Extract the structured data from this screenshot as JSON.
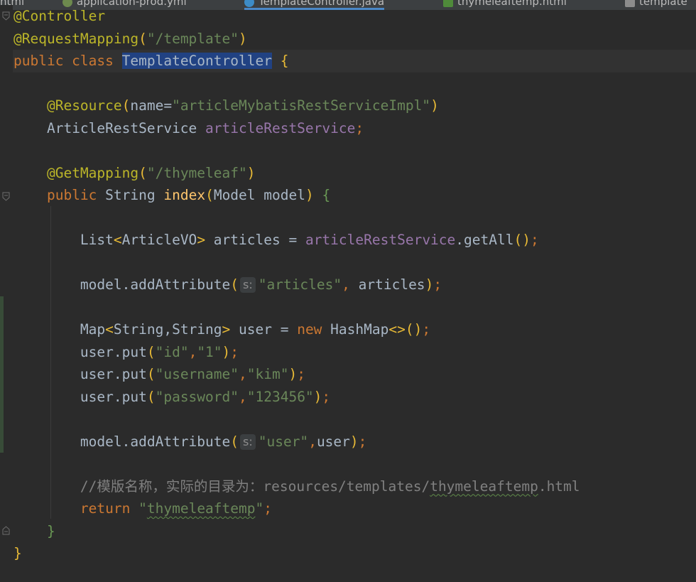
{
  "tabs": [
    {
      "label": "html"
    },
    {
      "label": "application-prod.yml"
    },
    {
      "label": "TemplateController.java"
    },
    {
      "label": "thymeleaftemp.html"
    },
    {
      "label": "template"
    }
  ],
  "code": {
    "l1": "@Controller",
    "l2_ann": "@RequestMapping",
    "l2_str": "\"/template\"",
    "l3_kw": "public class",
    "l3_cls": "TemplateController",
    "l5_ann": "@Resource",
    "l5_param": "name",
    "l5_str": "\"articleMybatisRestServiceImpl\"",
    "l6_type": "ArticleRestService",
    "l6_field": "articleRestService",
    "l8_ann": "@GetMapping",
    "l8_str": "\"/thymeleaf\"",
    "l9_kw": "public",
    "l9_type": "String",
    "l9_method": "index",
    "l9_params": "Model model",
    "l11_type": "List",
    "l11_generic": "ArticleVO",
    "l11_var": " articles = ",
    "l11_field": "articleRestService",
    "l11_call": ".getAll",
    "l13_call": "model.addAttribute",
    "hint": "s:",
    "l13_str": "\"articles\"",
    "l13_arg": " articles",
    "l15_type": "Map",
    "l15_generic": "String,String",
    "l15_var": " user = ",
    "l15_new": "new",
    "l15_ctor": " HashMap",
    "put": "user.put",
    "p1_k": "\"id\"",
    "p1_v": "\"1\"",
    "p2_k": "\"username\"",
    "p2_v": "\"kim\"",
    "p3_k": "\"password\"",
    "p3_v": "\"123456\"",
    "l20_str": "\"user\"",
    "l20_arg": "user",
    "l22_comment_a": "//模版名称，实际的目录为：resources/templates/",
    "l22_comment_b": "thymeleaftemp",
    "l22_comment_c": ".html",
    "l23_kw": "return",
    "l23_str_q1": "\"",
    "l23_str": "thymeleaftemp",
    "l23_str_q2": "\""
  },
  "colors": {
    "background": "#2b2b2b",
    "keyword": "#cc7832",
    "annotation": "#bbb529",
    "string": "#6a8759",
    "field": "#9876aa",
    "method": "#ffc66d",
    "selection": "#214283",
    "comment": "#808080"
  }
}
